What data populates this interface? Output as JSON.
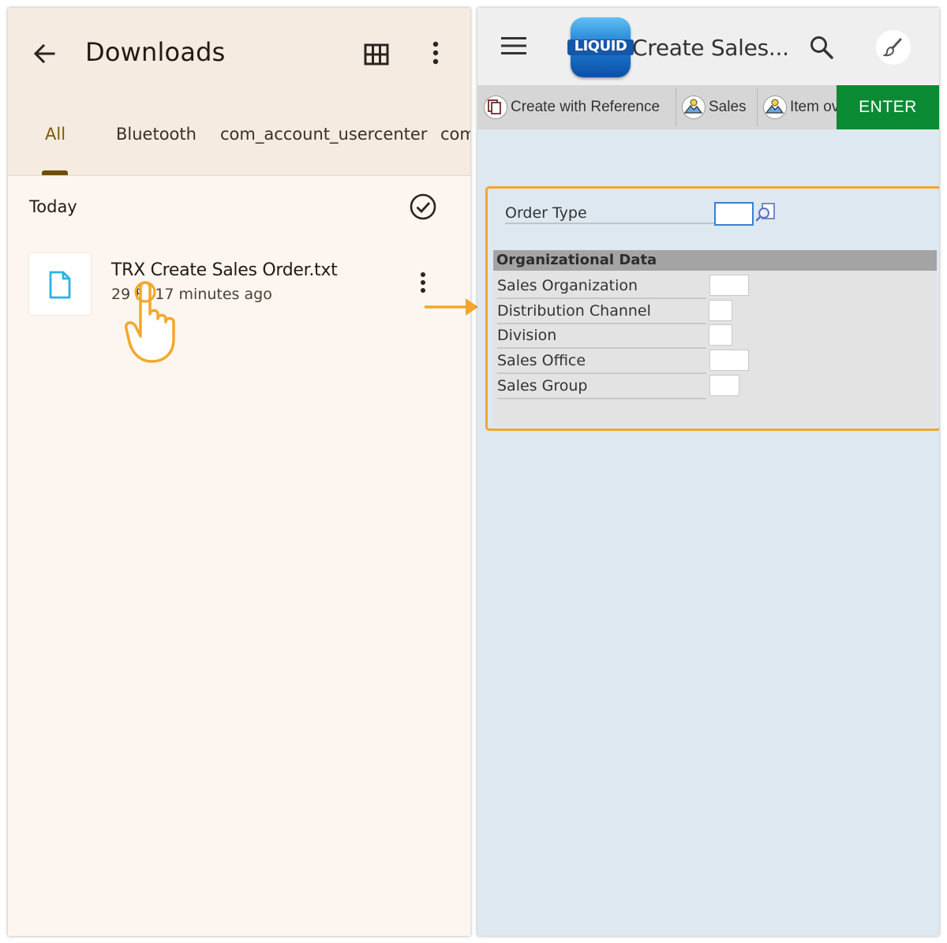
{
  "downloads": {
    "title": "Downloads",
    "tabs": [
      {
        "label": "All",
        "active": true
      },
      {
        "label": "Bluetooth",
        "active": false
      },
      {
        "label": "com_account_usercenter",
        "active": false
      },
      {
        "label": "com",
        "active": false
      }
    ],
    "section_label": "Today",
    "file": {
      "name": "TRX Create Sales Order.txt",
      "meta": "29 B, 17 minutes ago"
    },
    "icons": [
      "back-arrow-icon",
      "grid-view-icon",
      "more-vert-icon",
      "check-circle-icon",
      "file-icon",
      "tap-hand-icon"
    ],
    "colors": {
      "active_tab": "#7a5a06",
      "file_icon": "#27b3e6",
      "hand": "#f3a72a"
    }
  },
  "liquid": {
    "logo_text": "LIQUID",
    "title": "Create Sales...",
    "toolbar": {
      "create_ref": "Create with Reference",
      "sales": "Sales",
      "item": "Item ov",
      "enter": "ENTER"
    },
    "form": {
      "order_type_label": "Order Type",
      "order_type_value": "",
      "section_title": "Organizational Data",
      "fields": [
        {
          "label": "Sales Organization",
          "value": ""
        },
        {
          "label": "Distribution Channel",
          "value": ""
        },
        {
          "label": "Division",
          "value": ""
        },
        {
          "label": "Sales Office",
          "value": ""
        },
        {
          "label": "Sales Group",
          "value": ""
        }
      ]
    },
    "colors": {
      "enter": "#0a8a32",
      "highlight": "#f3a72a",
      "background": "#dde8f0"
    }
  }
}
